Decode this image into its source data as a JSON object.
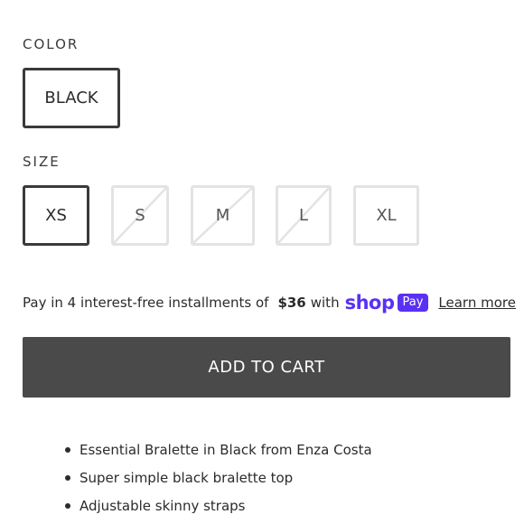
{
  "color": {
    "label": "COLOR",
    "options": [
      {
        "label": "BLACK",
        "selected": true
      }
    ]
  },
  "size": {
    "label": "SIZE",
    "options": [
      {
        "label": "XS",
        "selected": true,
        "available": true
      },
      {
        "label": "S",
        "selected": false,
        "available": false
      },
      {
        "label": "M",
        "selected": false,
        "available": false
      },
      {
        "label": "L",
        "selected": false,
        "available": false
      },
      {
        "label": "XL",
        "selected": false,
        "available": false
      }
    ]
  },
  "installments": {
    "prefix": "Pay in 4 interest-free installments of",
    "amount": "$36",
    "suffix": "with",
    "brand_shop": "shop",
    "brand_pay": "Pay",
    "learn_more": "Learn more",
    "brand_color": "#5a31f4"
  },
  "cart": {
    "button_label": "ADD TO CART",
    "button_color": "#4a4a4a"
  },
  "features": [
    "Essential Bralette in Black from Enza Costa",
    "Super simple black bralette top",
    "Adjustable skinny straps"
  ]
}
